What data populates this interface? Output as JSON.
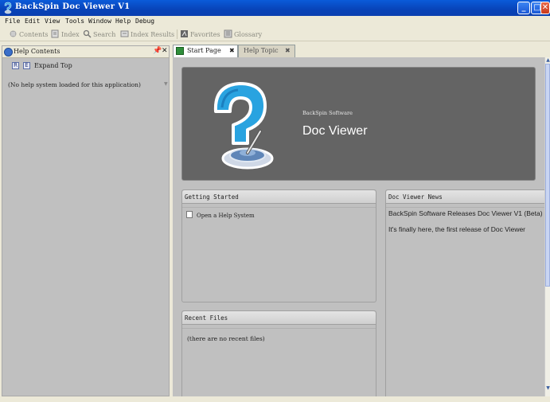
{
  "window": {
    "title": "BackSpin Doc Viewer V1",
    "controls": {
      "minimize": "_",
      "maximize": "□",
      "close": "✕"
    }
  },
  "menubar": {
    "items": [
      "File",
      "Edit",
      "View",
      "Tools",
      "Window",
      "Help",
      "Debug"
    ]
  },
  "toolbar": {
    "items": [
      {
        "label": "Contents",
        "icon": "contents-icon"
      },
      {
        "label": "Index",
        "icon": "index-icon"
      },
      {
        "label": "Search",
        "icon": "search-icon"
      },
      {
        "label": "Index Results",
        "icon": "index-results-icon"
      },
      {
        "label": "Favorites",
        "icon": "favorites-icon"
      },
      {
        "label": "Glossary",
        "icon": "glossary-icon"
      }
    ]
  },
  "left_panel": {
    "title": "Help Contents",
    "pin": "📌",
    "close": "✕",
    "expand_top_label": "Expand Top",
    "message": "(No help system loaded for this application)"
  },
  "tabs": [
    {
      "label": "Start Page",
      "active": true,
      "close": "✖"
    },
    {
      "label": "Help Topic",
      "active": false,
      "close": "✖"
    }
  ],
  "start_page": {
    "banner": {
      "company": "BackSpin Software",
      "product": "Doc Viewer"
    },
    "getting_started": {
      "title": "Getting Started",
      "items": [
        "Open a Help System"
      ]
    },
    "news": {
      "title": "Doc Viewer News",
      "lines": [
        "BackSpin Software Releases Doc Viewer V1 (Beta)",
        "It's finally here, the first release of Doc Viewer"
      ]
    },
    "recent_files": {
      "title": "Recent Files",
      "empty_message": "(there are no recent files)"
    }
  },
  "colors": {
    "titlebar": "#0843b8",
    "banner_bg": "#646464",
    "panel_bg": "#c0c0c0",
    "logo_blue": "#29a3e0"
  }
}
